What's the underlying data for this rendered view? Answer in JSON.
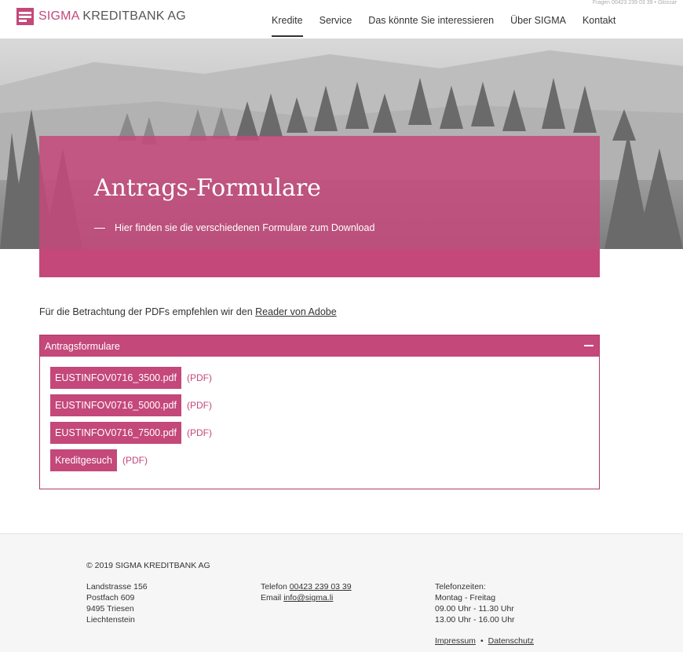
{
  "colors": {
    "accent": "#c4487a",
    "text": "#333333",
    "footer_bg": "#f6f6f6"
  },
  "header": {
    "topline_text": "Fragen 00423 239 03 39 •",
    "topline_link": "Glossar",
    "logo": {
      "brand": "SIGMA",
      "rest": "KREDITBANK AG"
    },
    "nav": [
      "Kredite",
      "Service",
      "Das könnte Sie interessieren",
      "Über SIGMA",
      "Kontakt"
    ],
    "active_nav": "Kredite"
  },
  "hero": {
    "title": "Antrags-Formulare",
    "subtitle": "Hier finden sie die verschiedenen Formulare zum Download"
  },
  "intro": {
    "text": "Für die Betrachtung der PDFs empfehlen wir den ",
    "link": "Reader von Adobe"
  },
  "accordion": {
    "title": "Antragsformulare",
    "files": [
      {
        "label": "EUSTINFOV0716_3500.pdf",
        "ext": "(PDF)"
      },
      {
        "label": "EUSTINFOV0716_5000.pdf",
        "ext": "(PDF)"
      },
      {
        "label": "EUSTINFOV0716_7500.pdf",
        "ext": "(PDF)"
      },
      {
        "label": "Kreditgesuch",
        "ext": "(PDF)"
      }
    ]
  },
  "footer": {
    "copyright": "© 2019 SIGMA KREDITBANK AG",
    "address": [
      "Landstrasse 156",
      "Postfach 609",
      "9495 Triesen",
      "Liechtenstein"
    ],
    "phone_label": "Telefon ",
    "phone": "00423 239 03 39",
    "email_label": "Email ",
    "email": "info@sigma.li",
    "hours": [
      "Telefonzeiten:",
      "Montag - Freitag",
      "09.00 Uhr - 11.30 Uhr",
      "13.00 Uhr - 16.00 Uhr"
    ],
    "impressum": "Impressum",
    "separator": "•",
    "datenschutz": "Datenschutz"
  }
}
